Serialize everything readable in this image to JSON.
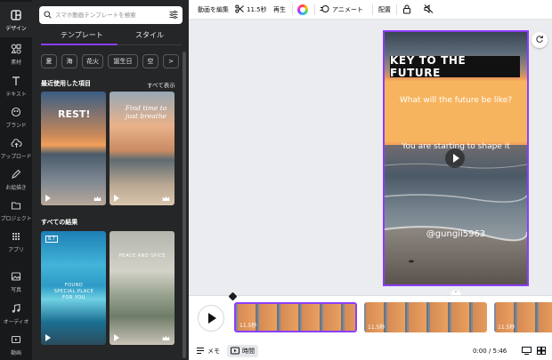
{
  "sidebar": {
    "items": [
      {
        "label": "デザイン",
        "icon": "layout-icon"
      },
      {
        "label": "素材",
        "icon": "elements-icon"
      },
      {
        "label": "テキスト",
        "icon": "text-icon"
      },
      {
        "label": "ブランド",
        "icon": "brand-icon"
      },
      {
        "label": "アップロード",
        "icon": "upload-icon"
      },
      {
        "label": "お絵描き",
        "icon": "draw-icon"
      },
      {
        "label": "プロジェクト",
        "icon": "folder-icon"
      },
      {
        "label": "アプリ",
        "icon": "apps-icon"
      },
      {
        "label": "写真",
        "icon": "photo-icon"
      },
      {
        "label": "オーディオ",
        "icon": "audio-icon"
      },
      {
        "label": "動画",
        "icon": "video-icon"
      }
    ]
  },
  "panel": {
    "search_placeholder": "スマホ動画テンプレートを検索",
    "tabs": [
      "テンプレート",
      "スタイル"
    ],
    "chips": [
      "夏",
      "海",
      "花火",
      "誕生日",
      "空"
    ],
    "recent_title": "最近使用した項目",
    "see_all": "すべて表示",
    "all_results_title": "すべての結果",
    "thumbs": [
      {
        "text": "REST!"
      },
      {
        "text": "Find time to just breathe"
      },
      {
        "text": "FOUND SPECIAL PLACE FOR YOU",
        "badge": "B.T"
      },
      {
        "text": "PEACE AND SPICE"
      }
    ]
  },
  "toolbar": {
    "edit_video": "動画を編集",
    "duration": "11.5秒",
    "playback": "再生",
    "animate": "アニメート",
    "position": "配置"
  },
  "canvas": {
    "title": "KEY TO THE FUTURE",
    "question": "What will the future be like?",
    "subtitle": "You are starting to shape it",
    "handle": "@gungii5963"
  },
  "timeline": {
    "clips": [
      {
        "duration": "11.5秒"
      },
      {
        "duration": "11.5秒"
      },
      {
        "duration": "11.5秒"
      }
    ],
    "notes": "メモ",
    "time_label": "時間",
    "timecode": "0:00 / 5:46"
  },
  "colors": {
    "accent": "#8b3dff",
    "rail_bg": "#18191b",
    "panel_bg": "#252627"
  }
}
